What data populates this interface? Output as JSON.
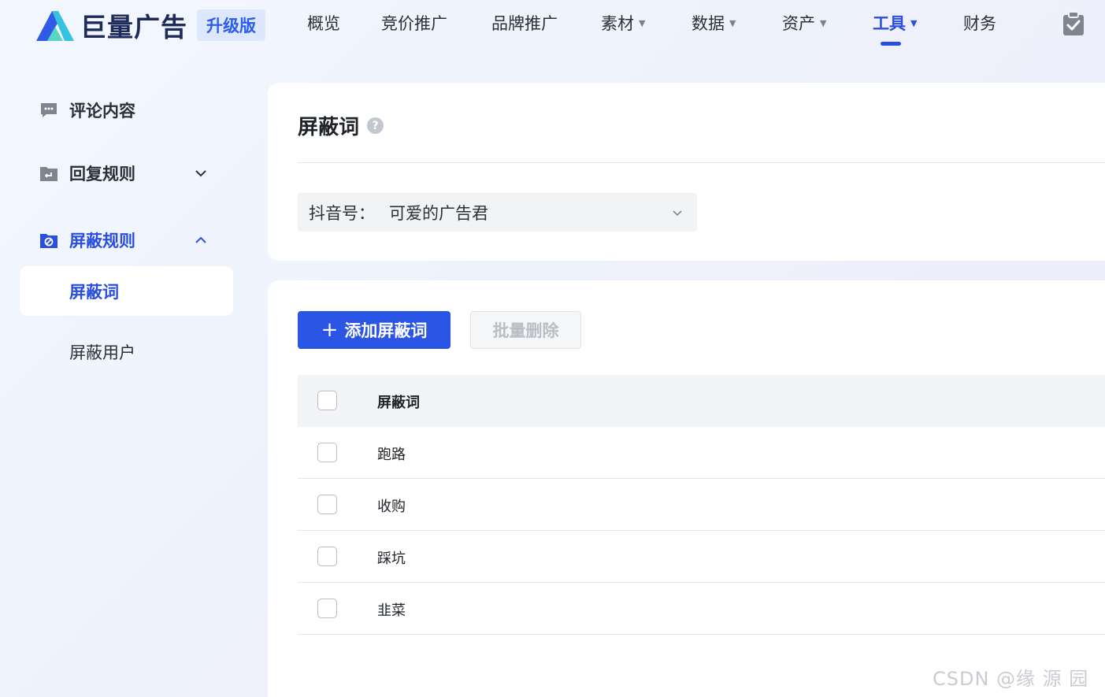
{
  "header": {
    "brand_name": "巨量广告",
    "version_badge": "升级版",
    "nav": [
      {
        "label": "概览",
        "has_dropdown": false
      },
      {
        "label": "竞价推广",
        "has_dropdown": false
      },
      {
        "label": "品牌推广",
        "has_dropdown": false
      },
      {
        "label": "素材",
        "has_dropdown": true
      },
      {
        "label": "数据",
        "has_dropdown": true
      },
      {
        "label": "资产",
        "has_dropdown": true
      },
      {
        "label": "工具",
        "has_dropdown": true,
        "active": true
      },
      {
        "label": "财务",
        "has_dropdown": false
      }
    ],
    "right_icon": "clipboard-check-icon"
  },
  "sidebar": {
    "groups": [
      {
        "label": "评论内容",
        "icon": "comment-icon"
      },
      {
        "label": "回复规则",
        "icon": "reply-icon",
        "expanded": false
      },
      {
        "label": "屏蔽规则",
        "icon": "block-folder-icon",
        "expanded": true,
        "active": true
      }
    ],
    "sub_items": [
      {
        "label": "屏蔽词",
        "selected": true
      },
      {
        "label": "屏蔽用户",
        "selected": false
      }
    ]
  },
  "page": {
    "title": "屏蔽词",
    "help_icon": "?",
    "account_select": {
      "prefix": "抖音号：",
      "value": "可爱的广告君"
    }
  },
  "toolbar": {
    "add_label": "添加屏蔽词",
    "add_icon": "+",
    "batch_delete_label": "批量删除"
  },
  "table": {
    "column_header": "屏蔽词",
    "rows": [
      "跑路",
      "收购",
      "踩坑",
      "韭菜"
    ]
  },
  "watermark": "CSDN @缘 源 园",
  "colors": {
    "accent": "#2a55e5",
    "active_text": "#2a4fe0",
    "disabled_text": "#b9bdc4"
  }
}
